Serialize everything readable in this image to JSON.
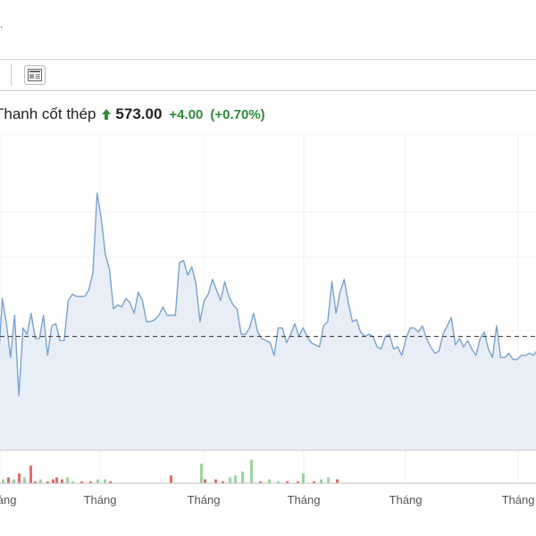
{
  "top": {
    "mark": "."
  },
  "toolbar": {
    "icon": "news-panel-icon"
  },
  "header": {
    "name": "Thanh cốt thép",
    "arrow": "up-arrow-icon",
    "price": "573.00",
    "change": "+4.00",
    "change_pct": "(+0.70%)",
    "up_color": "#2e8b3a",
    "down_color": "#d9534f"
  },
  "chart_data": {
    "type": "area",
    "line_color": "#7aa3cf",
    "fill_color": "#e8eef6",
    "reference_line": "dashed",
    "x_tick_labels": [
      "Tháng",
      "Tháng",
      "Tháng",
      "Tháng",
      "Tháng",
      "Tháng"
    ],
    "series": [
      {
        "values": [
          0.4,
          0.72,
          0.6,
          0.44,
          0.64,
          0.26,
          0.58,
          0.55,
          0.65,
          0.53,
          0.53,
          0.64,
          0.45,
          0.59,
          0.6,
          0.52,
          0.52,
          0.71,
          0.74,
          0.73,
          0.73,
          0.73,
          0.76,
          0.84,
          1.22,
          1.1,
          0.93,
          0.86,
          0.67,
          0.69,
          0.68,
          0.72,
          0.7,
          0.65,
          0.75,
          0.71,
          0.61,
          0.61,
          0.62,
          0.64,
          0.68,
          0.64,
          0.64,
          0.64,
          0.89,
          0.9,
          0.83,
          0.87,
          0.79,
          0.61,
          0.71,
          0.74,
          0.81,
          0.76,
          0.71,
          0.8,
          0.73,
          0.69,
          0.67,
          0.55,
          0.55,
          0.58,
          0.65,
          0.56,
          0.53,
          0.52,
          0.51,
          0.45,
          0.58,
          0.58,
          0.51,
          0.55,
          0.6,
          0.54,
          0.58,
          0.54,
          0.51,
          0.5,
          0.49,
          0.59,
          0.61,
          0.8,
          0.65,
          0.75,
          0.81,
          0.7,
          0.61,
          0.62,
          0.56,
          0.54,
          0.55,
          0.54,
          0.49,
          0.48,
          0.54,
          0.55,
          0.48,
          0.49,
          0.45,
          0.53,
          0.58,
          0.58,
          0.56,
          0.59,
          0.53,
          0.49,
          0.46,
          0.47,
          0.55,
          0.59,
          0.63,
          0.5,
          0.53,
          0.49,
          0.52,
          0.48,
          0.45,
          0.53,
          0.56,
          0.48,
          0.44,
          0.59,
          0.44,
          0.44,
          0.46,
          0.43,
          0.43,
          0.45,
          0.45,
          0.46,
          0.45,
          0.48
        ]
      }
    ],
    "volume": [
      {
        "v": 0.2,
        "color": "#4caf50"
      },
      {
        "v": 0.3,
        "color": "#d9534f"
      },
      {
        "v": 0.2,
        "color": "#4caf50"
      },
      {
        "v": 0.5,
        "color": "#d9534f"
      },
      {
        "v": 0.3,
        "color": "#4caf50"
      },
      {
        "v": 0.9,
        "color": "#d9534f"
      },
      {
        "v": 0.1,
        "color": "#d9534f"
      },
      {
        "v": 0.2,
        "color": "#4caf50"
      },
      {
        "v": 0.1,
        "color": "#d9534f"
      },
      {
        "v": 0.2,
        "color": "#d9534f"
      },
      {
        "v": 0.3,
        "color": "#d9534f"
      },
      {
        "v": 0.2,
        "color": "#d9534f"
      },
      {
        "v": 0.3,
        "color": "#4caf50"
      },
      {
        "v": 0.1,
        "color": "#4caf50"
      },
      {
        "v": 0.1,
        "color": "#d9534f"
      },
      {
        "v": 0.1,
        "color": "#d9534f"
      },
      {
        "v": 0.2,
        "color": "#4caf50"
      },
      {
        "v": 0.2,
        "color": "#4caf50"
      },
      {
        "v": 0.1,
        "color": "#d9534f"
      },
      {
        "v": 0.4,
        "color": "#d9534f"
      },
      {
        "v": 1.0,
        "color": "#4caf50"
      },
      {
        "v": 0.2,
        "color": "#d9534f"
      },
      {
        "v": 0.2,
        "color": "#d9534f"
      },
      {
        "v": 0.1,
        "color": "#d9534f"
      },
      {
        "v": 0.3,
        "color": "#4caf50"
      },
      {
        "v": 0.4,
        "color": "#4caf50"
      },
      {
        "v": 0.6,
        "color": "#4caf50"
      },
      {
        "v": 1.2,
        "color": "#4caf50"
      },
      {
        "v": 0.1,
        "color": "#d9534f"
      },
      {
        "v": 0.2,
        "color": "#4caf50"
      },
      {
        "v": 0.1,
        "color": "#4caf50"
      },
      {
        "v": 0.1,
        "color": "#d9534f"
      },
      {
        "v": 0.1,
        "color": "#d9534f"
      },
      {
        "v": 0.5,
        "color": "#4caf50"
      },
      {
        "v": 0.1,
        "color": "#d9534f"
      },
      {
        "v": 0.2,
        "color": "#4caf50"
      },
      {
        "v": 0.3,
        "color": "#4caf50"
      },
      {
        "v": 0.2,
        "color": "#d9534f"
      }
    ],
    "volume_x": [
      2,
      8,
      14,
      20,
      26,
      33,
      38,
      44,
      52,
      58,
      62,
      68,
      74,
      80,
      90,
      100,
      108,
      116,
      122,
      190,
      224,
      228,
      240,
      248,
      256,
      262,
      270,
      280,
      290,
      300,
      310,
      320,
      332,
      338,
      350,
      358,
      366,
      376,
      382,
      392,
      404,
      412,
      422,
      432,
      440,
      450,
      466,
      478,
      494,
      510,
      530,
      556,
      580,
      592,
      598
    ]
  }
}
